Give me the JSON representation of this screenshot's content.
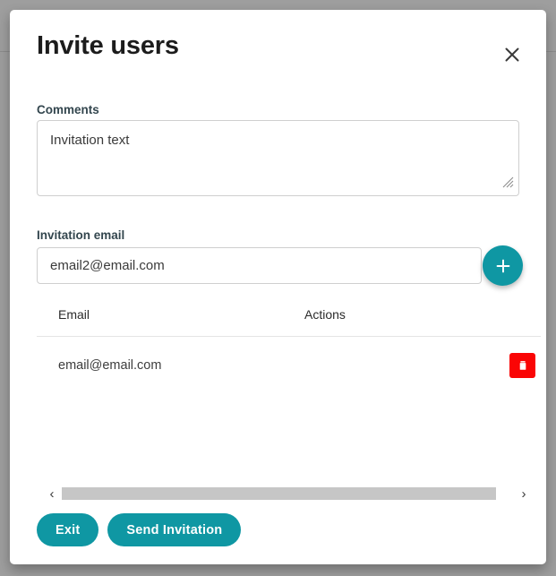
{
  "dialog": {
    "title": "Invite users",
    "close_icon": "close-icon"
  },
  "form": {
    "comments": {
      "label": "Comments",
      "value": "Invitation text",
      "placeholder": ""
    },
    "invitation_email": {
      "label": "Invitation email",
      "value": "email2@email.com",
      "placeholder": "",
      "add_button_icon": "plus-icon"
    }
  },
  "table": {
    "columns": [
      "Email",
      "Actions"
    ],
    "rows": [
      {
        "email": "email@email.com",
        "action_icon": "trash-icon"
      }
    ]
  },
  "scrollbar": {
    "left_arrow": "‹",
    "right_arrow": "›"
  },
  "footer": {
    "exit_label": "Exit",
    "send_label": "Send Invitation"
  },
  "colors": {
    "accent_teal": "#0f97a3",
    "danger_red": "#fa0505",
    "backdrop": "#9e9e9e",
    "label_text": "#33464e"
  }
}
